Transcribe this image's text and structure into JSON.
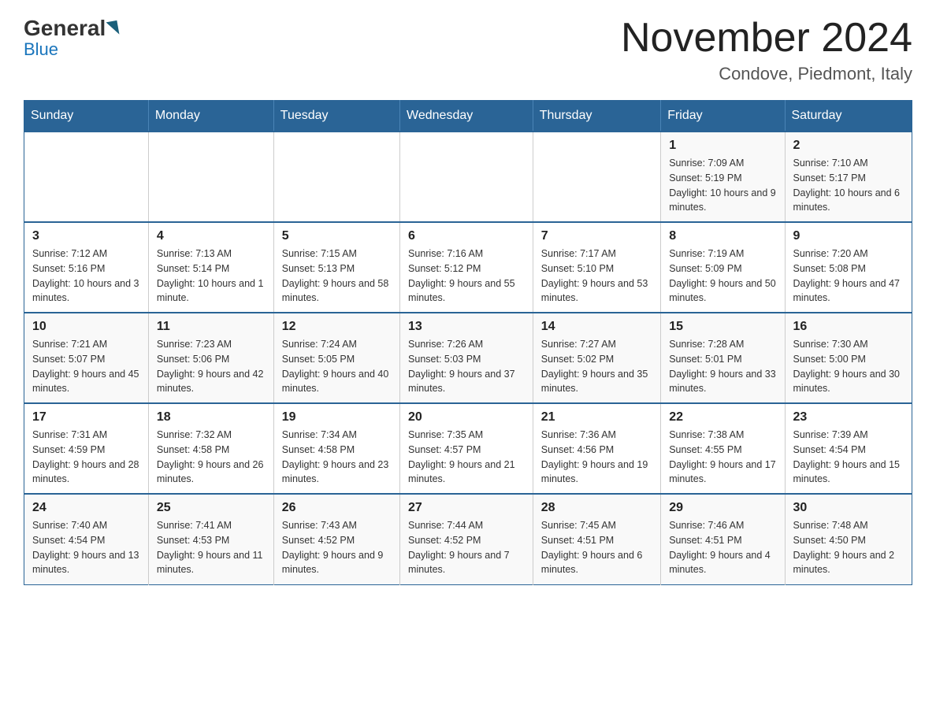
{
  "header": {
    "logo_general": "General",
    "logo_blue": "Blue",
    "month_year": "November 2024",
    "location": "Condove, Piedmont, Italy"
  },
  "weekdays": [
    "Sunday",
    "Monday",
    "Tuesday",
    "Wednesday",
    "Thursday",
    "Friday",
    "Saturday"
  ],
  "weeks": [
    [
      {
        "day": "",
        "info": ""
      },
      {
        "day": "",
        "info": ""
      },
      {
        "day": "",
        "info": ""
      },
      {
        "day": "",
        "info": ""
      },
      {
        "day": "",
        "info": ""
      },
      {
        "day": "1",
        "info": "Sunrise: 7:09 AM\nSunset: 5:19 PM\nDaylight: 10 hours and 9 minutes."
      },
      {
        "day": "2",
        "info": "Sunrise: 7:10 AM\nSunset: 5:17 PM\nDaylight: 10 hours and 6 minutes."
      }
    ],
    [
      {
        "day": "3",
        "info": "Sunrise: 7:12 AM\nSunset: 5:16 PM\nDaylight: 10 hours and 3 minutes."
      },
      {
        "day": "4",
        "info": "Sunrise: 7:13 AM\nSunset: 5:14 PM\nDaylight: 10 hours and 1 minute."
      },
      {
        "day": "5",
        "info": "Sunrise: 7:15 AM\nSunset: 5:13 PM\nDaylight: 9 hours and 58 minutes."
      },
      {
        "day": "6",
        "info": "Sunrise: 7:16 AM\nSunset: 5:12 PM\nDaylight: 9 hours and 55 minutes."
      },
      {
        "day": "7",
        "info": "Sunrise: 7:17 AM\nSunset: 5:10 PM\nDaylight: 9 hours and 53 minutes."
      },
      {
        "day": "8",
        "info": "Sunrise: 7:19 AM\nSunset: 5:09 PM\nDaylight: 9 hours and 50 minutes."
      },
      {
        "day": "9",
        "info": "Sunrise: 7:20 AM\nSunset: 5:08 PM\nDaylight: 9 hours and 47 minutes."
      }
    ],
    [
      {
        "day": "10",
        "info": "Sunrise: 7:21 AM\nSunset: 5:07 PM\nDaylight: 9 hours and 45 minutes."
      },
      {
        "day": "11",
        "info": "Sunrise: 7:23 AM\nSunset: 5:06 PM\nDaylight: 9 hours and 42 minutes."
      },
      {
        "day": "12",
        "info": "Sunrise: 7:24 AM\nSunset: 5:05 PM\nDaylight: 9 hours and 40 minutes."
      },
      {
        "day": "13",
        "info": "Sunrise: 7:26 AM\nSunset: 5:03 PM\nDaylight: 9 hours and 37 minutes."
      },
      {
        "day": "14",
        "info": "Sunrise: 7:27 AM\nSunset: 5:02 PM\nDaylight: 9 hours and 35 minutes."
      },
      {
        "day": "15",
        "info": "Sunrise: 7:28 AM\nSunset: 5:01 PM\nDaylight: 9 hours and 33 minutes."
      },
      {
        "day": "16",
        "info": "Sunrise: 7:30 AM\nSunset: 5:00 PM\nDaylight: 9 hours and 30 minutes."
      }
    ],
    [
      {
        "day": "17",
        "info": "Sunrise: 7:31 AM\nSunset: 4:59 PM\nDaylight: 9 hours and 28 minutes."
      },
      {
        "day": "18",
        "info": "Sunrise: 7:32 AM\nSunset: 4:58 PM\nDaylight: 9 hours and 26 minutes."
      },
      {
        "day": "19",
        "info": "Sunrise: 7:34 AM\nSunset: 4:58 PM\nDaylight: 9 hours and 23 minutes."
      },
      {
        "day": "20",
        "info": "Sunrise: 7:35 AM\nSunset: 4:57 PM\nDaylight: 9 hours and 21 minutes."
      },
      {
        "day": "21",
        "info": "Sunrise: 7:36 AM\nSunset: 4:56 PM\nDaylight: 9 hours and 19 minutes."
      },
      {
        "day": "22",
        "info": "Sunrise: 7:38 AM\nSunset: 4:55 PM\nDaylight: 9 hours and 17 minutes."
      },
      {
        "day": "23",
        "info": "Sunrise: 7:39 AM\nSunset: 4:54 PM\nDaylight: 9 hours and 15 minutes."
      }
    ],
    [
      {
        "day": "24",
        "info": "Sunrise: 7:40 AM\nSunset: 4:54 PM\nDaylight: 9 hours and 13 minutes."
      },
      {
        "day": "25",
        "info": "Sunrise: 7:41 AM\nSunset: 4:53 PM\nDaylight: 9 hours and 11 minutes."
      },
      {
        "day": "26",
        "info": "Sunrise: 7:43 AM\nSunset: 4:52 PM\nDaylight: 9 hours and 9 minutes."
      },
      {
        "day": "27",
        "info": "Sunrise: 7:44 AM\nSunset: 4:52 PM\nDaylight: 9 hours and 7 minutes."
      },
      {
        "day": "28",
        "info": "Sunrise: 7:45 AM\nSunset: 4:51 PM\nDaylight: 9 hours and 6 minutes."
      },
      {
        "day": "29",
        "info": "Sunrise: 7:46 AM\nSunset: 4:51 PM\nDaylight: 9 hours and 4 minutes."
      },
      {
        "day": "30",
        "info": "Sunrise: 7:48 AM\nSunset: 4:50 PM\nDaylight: 9 hours and 2 minutes."
      }
    ]
  ]
}
